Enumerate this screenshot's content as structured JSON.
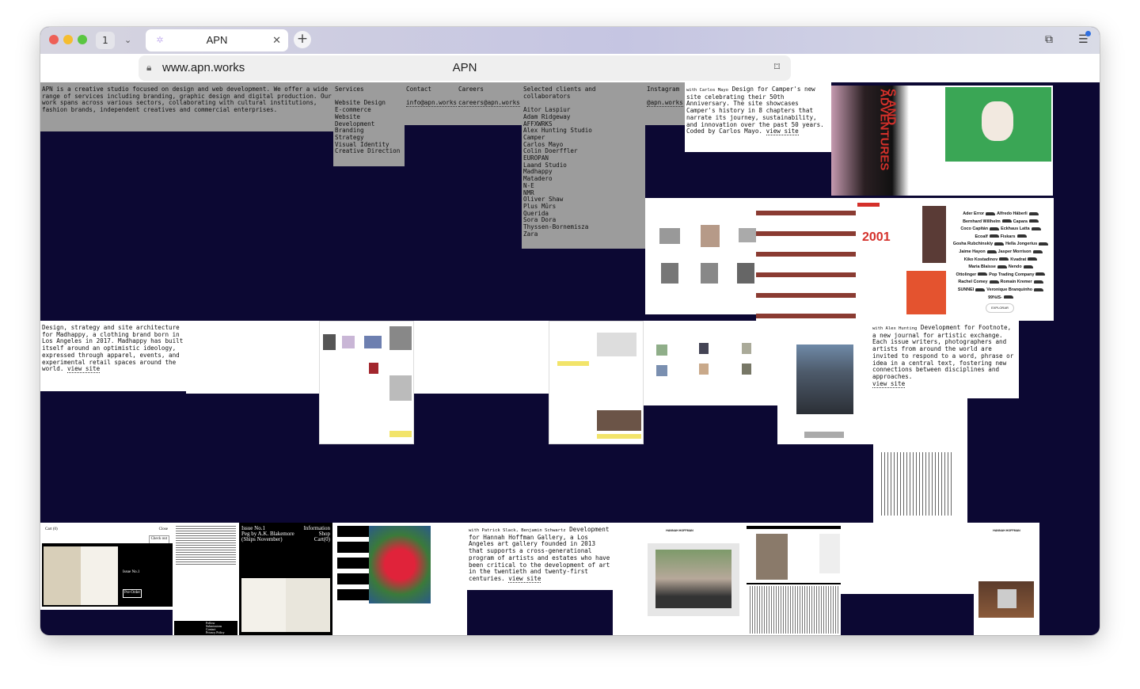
{
  "browser": {
    "tab_count": "1",
    "tab_title": "APN",
    "url": "www.apn.works",
    "page_title": "APN"
  },
  "intro": "APN is a creative studio focused on design and web development. We offer a wide range of services including branding, graphic design and digital production. Our work spans across various sectors, collaborating with cultural institutions, fashion brands, independent creatives and commercial enterprises.",
  "services": {
    "heading": "Services",
    "items": [
      "Website Design",
      "E-commerce",
      "Website Development",
      "Branding",
      "Strategy",
      "Visual Identity",
      "Creative Direction"
    ]
  },
  "contact": {
    "heading": "Contact",
    "email": "info@apn.works"
  },
  "careers": {
    "heading": "Careers",
    "email": "careers@apn.works"
  },
  "clients": {
    "heading": "Selected clients and collaborators",
    "items": [
      "Aitor Laspiur",
      "Adam Ridgeway",
      "AFFXWRKS",
      "Alex Hunting Studio",
      "Camper",
      "Carlos Mayo",
      "Colin Doerffler",
      "EUROPAN",
      "Laand Studio",
      "Madhappy",
      "Matadero",
      "N-E",
      "NMR",
      "Oliver Shaw",
      "Plus Mûrs",
      "Querida",
      "Sora Dora",
      "Thyssen-Bornemisza",
      "Zara"
    ]
  },
  "instagram": {
    "heading": "Instagram",
    "handle": "@apn.works"
  },
  "projects": {
    "camper": {
      "with": "with Carlos Mayo",
      "text": "Design for Camper's new site celebrating their 50th Anniversary. The site showcases Camper's history in 8 chapters that narrate its journey, sustainability, and innovation over the past 50 years. Coded by Carlos Mayo.",
      "link": "view site",
      "thumb_year": "2001",
      "thumb_vertical": "S AND ADVENTURES",
      "thumb_button": "EXPLORAR",
      "brands": [
        "Ader Error",
        "Alfredo Häberli",
        "Bernhard Willhelm",
        "Capara",
        "Coco Capitán",
        "Eckhaus Latta",
        "Ecoalf",
        "Fiskars",
        "Gosha Rubchinskiy",
        "Hella Jongerius",
        "Jaime Hayon",
        "Jasper Morrison",
        "Kiko Kostadinov",
        "Kvadrat",
        "Maria Blaisse",
        "Nendo",
        "Ottolinger",
        "Pop Trading Company",
        "Rachel Comey",
        "Romain Kremer",
        "SUNNEI",
        "Veronique Branquinho",
        "99%IS-"
      ]
    },
    "madhappy": {
      "text": "Design, strategy and site architecture for Madhappy, a clothing brand born in Los Angeles in 2017. Madhappy has built itself around an optimistic ideology, expressed through apparel, events, and experimental retail spaces around the world.",
      "link": "view site"
    },
    "footnote": {
      "with": "with Alex Hunting",
      "text": "Development for Footnote, a new journal for artistic exchange. Each issue writers, photographers and artists from around the world are invited to respond to a word, phrase or idea in a central text, fostering new connections between disciplines and approaches.",
      "link": "view site",
      "issue": "Issue No.1",
      "book": "Peg by A.K. Blakemore",
      "ships": "(Ships November)",
      "nav": [
        "Information",
        "Shop",
        "Cart(0)"
      ],
      "cart": "Cart (0)",
      "close": "Close",
      "checkout": "Check out",
      "preorder": "Pre-Order",
      "footer_links": [
        "Follow",
        "Submissions",
        "Contact",
        "Privacy Policy"
      ]
    },
    "hannah": {
      "with": "with Patrick Slack, Benjamin Schwartz",
      "text": "Development for Hannah Hoffman Gallery, a Los Angeles art gallery founded in 2013 that supports a cross-generational program of artists and estates who have been critical to the development of art in the twentieth and twenty-first centuries.",
      "link": "view site",
      "logo": "HANNAH HOFFMAN"
    }
  },
  "colors": {
    "page_bg": "#0c0833",
    "panel_gray": "#9c9c9c",
    "camper_red": "#d4302a",
    "green": "#3aa655"
  }
}
